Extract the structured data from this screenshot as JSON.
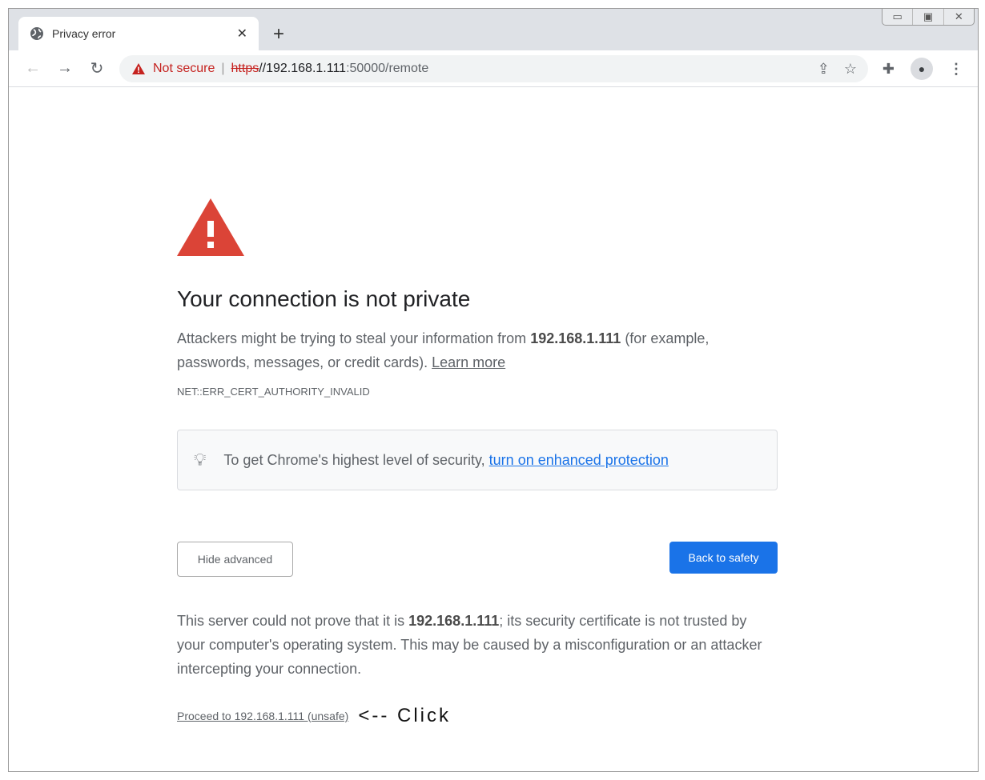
{
  "window": {
    "controls": {
      "minimize": "▭",
      "maximize": "▣",
      "close": "✕"
    }
  },
  "tab": {
    "title": "Privacy error",
    "icon": "globe-icon"
  },
  "omnibox": {
    "security": "Not secure",
    "scheme": "https",
    "host": "//192.168.1.111",
    "path": ":50000/remote"
  },
  "main": {
    "heading": "Your connection is not private",
    "p1_a": "Attackers might be trying to steal your information from ",
    "p1_host": "192.168.1.111",
    "p1_b": " (for example, passwords, messages, or credit cards). ",
    "learn_more": "Learn more",
    "error_code": "NET::ERR_CERT_AUTHORITY_INVALID",
    "tip_text": "To get Chrome's highest level of security, ",
    "tip_link": "turn on enhanced protection",
    "hide_advanced": "Hide advanced",
    "back_to_safety": "Back to safety",
    "p2_a": "This server could not prove that it is ",
    "p2_host": "192.168.1.111",
    "p2_b": "; its security certificate is not trusted by your computer's operating system. This may be caused by a misconfiguration or an attacker intercepting your connection.",
    "proceed": "Proceed to 192.168.1.111 (unsafe)",
    "annotation": "<-- Click"
  },
  "colors": {
    "warning": "#db4437",
    "link": "#1a73e8",
    "not_secure": "#c5221f"
  }
}
